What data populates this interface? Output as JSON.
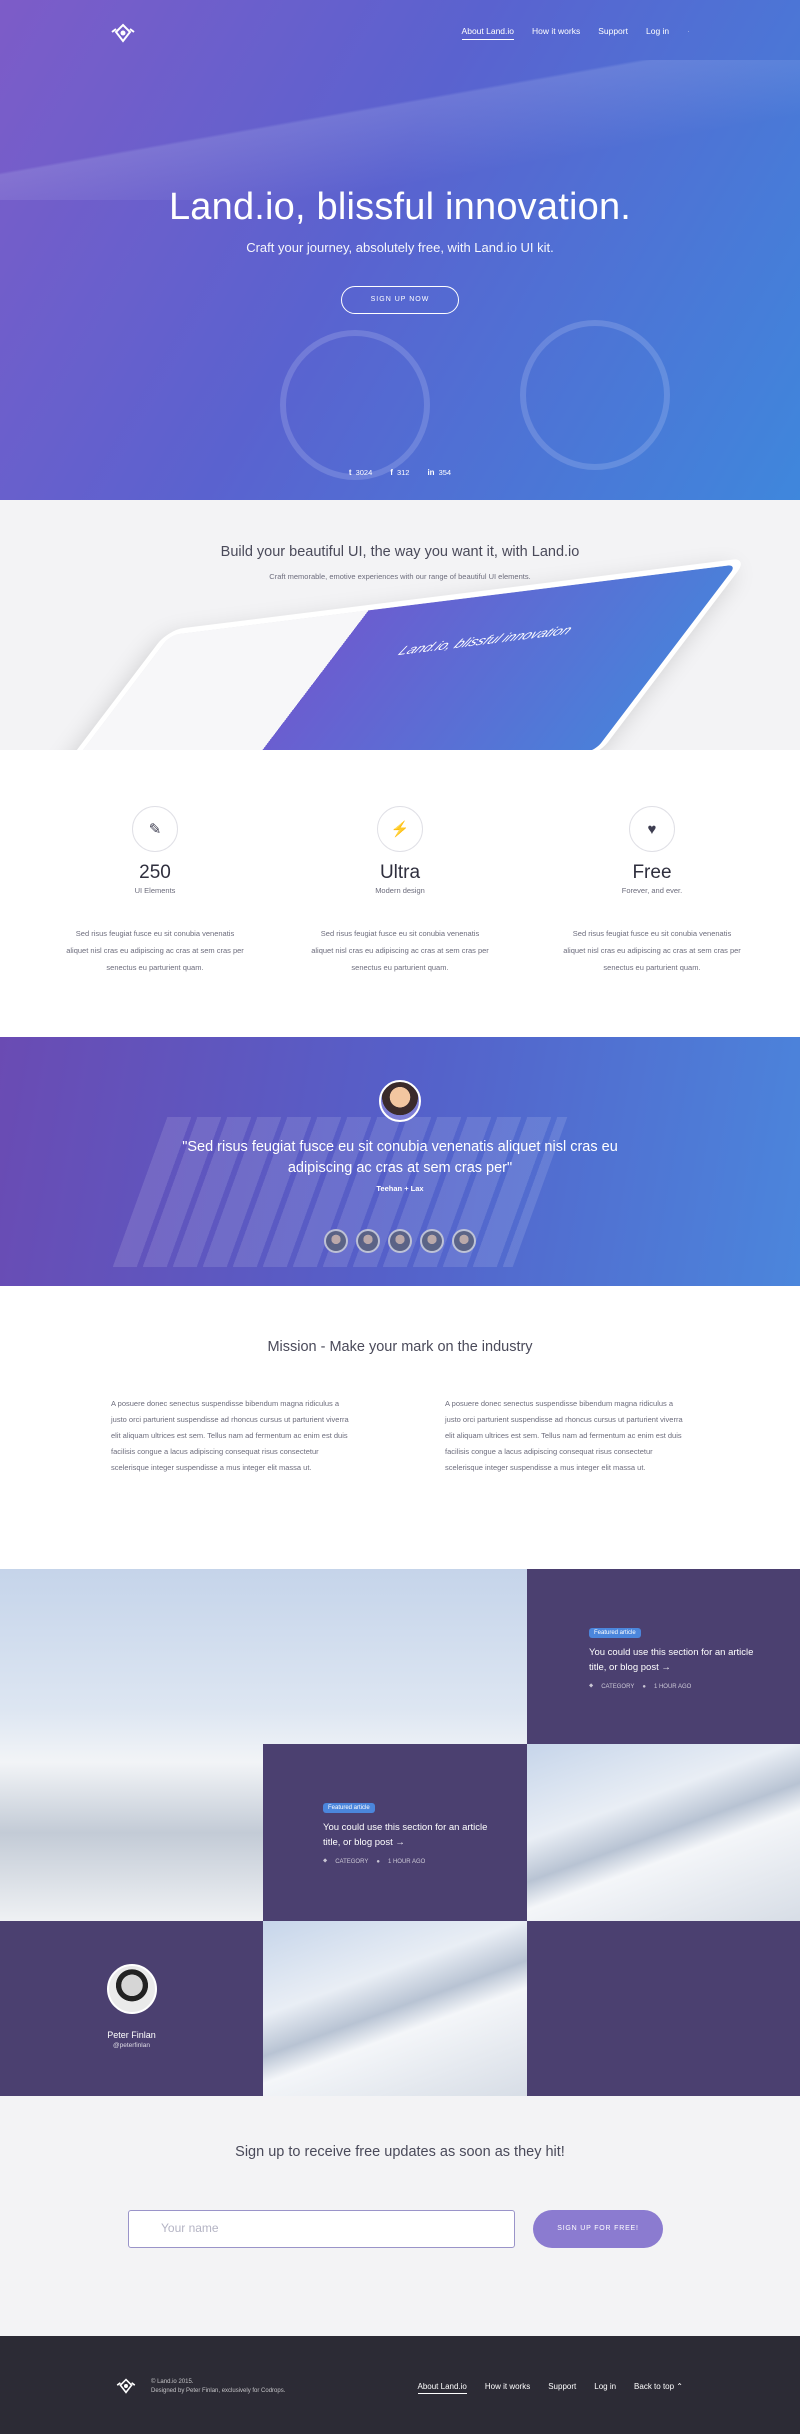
{
  "nav": {
    "logo": "land-logo",
    "links": [
      "About Land.io",
      "How it works",
      "Support",
      "Log in"
    ],
    "extra": "·"
  },
  "hero": {
    "title": "Land.io, blissful innovation.",
    "subtitle": "Craft your journey, absolutely free, with Land.io UI kit.",
    "cta": "SIGN UP NOW",
    "social": [
      {
        "icon": "twitter-icon",
        "glyph": "t",
        "count": "3024"
      },
      {
        "icon": "facebook-icon",
        "glyph": "f",
        "count": "312"
      },
      {
        "icon": "linkedin-icon",
        "glyph": "in",
        "count": "354"
      }
    ]
  },
  "showcase": {
    "title": "Build your beautiful UI, the way you want it, with Land.io",
    "subtitle": "Craft memorable, emotive experiences with our range of beautiful UI elements.",
    "tablet_title": "Land.io, blissful innovation"
  },
  "features": [
    {
      "icon": "pen-icon",
      "glyph": "✎",
      "big": "250",
      "small": "UI Elements",
      "desc": "Sed risus feugiat fusce eu sit conubia venenatis aliquet nisl cras eu adipiscing ac cras at sem cras per senectus eu parturient quam."
    },
    {
      "icon": "lightning-icon",
      "glyph": "⚡",
      "big": "Ultra",
      "small": "Modern design",
      "desc": "Sed risus feugiat fusce eu sit conubia venenatis aliquet nisl cras eu adipiscing ac cras at sem cras per senectus eu parturient quam."
    },
    {
      "icon": "heart-icon",
      "glyph": "♥",
      "big": "Free",
      "small": "Forever, and ever.",
      "desc": "Sed risus feugiat fusce eu sit conubia venenatis aliquet nisl cras eu adipiscing ac cras at sem cras per senectus eu parturient quam."
    }
  ],
  "testimonial": {
    "quote": "\"Sed risus feugiat fusce eu sit conubia venenatis aliquet nisl cras eu adipiscing ac cras at sem cras per\"",
    "author": "Teehan + Lax"
  },
  "mission": {
    "title": "Mission - Make your mark on the industry",
    "col1": "A posuere donec senectus suspendisse bibendum magna ridiculus a justo orci parturient suspendisse ad rhoncus cursus ut parturient viverra elit aliquam ultrices est sem. Tellus nam ad fermentum ac enim est duis facilisis congue a lacus adipiscing consequat risus consectetur scelerisque integer suspendisse a mus integer elit massa ut.",
    "col2": "A posuere donec senectus suspendisse bibendum magna ridiculus a justo orci parturient suspendisse ad rhoncus cursus ut parturient viverra elit aliquam ultrices est sem. Tellus nam ad fermentum ac enim est duis facilisis congue a lacus adipiscing consequat risus consectetur scelerisque integer suspendisse a mus integer elit massa ut."
  },
  "articles": [
    {
      "badge": "Featured article",
      "title": "You could use this section for an article title, or blog post →",
      "category": "CATEGORY",
      "time": "1 HOUR AGO"
    },
    {
      "badge": "Featured article",
      "title": "You could use this section for an article title, or blog post →",
      "category": "CATEGORY",
      "time": "1 HOUR AGO"
    }
  ],
  "profile": {
    "name": "Peter Finlan",
    "handle": "@peterfinlan"
  },
  "signup": {
    "title": "Sign up to receive free updates as soon as they hit!",
    "placeholder": "Your name",
    "button": "SIGN UP FOR FREE!"
  },
  "footer": {
    "copy1": "© Land.io 2015.",
    "copy2": "Designed by Peter Finlan, exclusively for Codrops.",
    "links": [
      "About Land.io",
      "How it works",
      "Support",
      "Log in",
      "Back to top ⌃"
    ]
  }
}
